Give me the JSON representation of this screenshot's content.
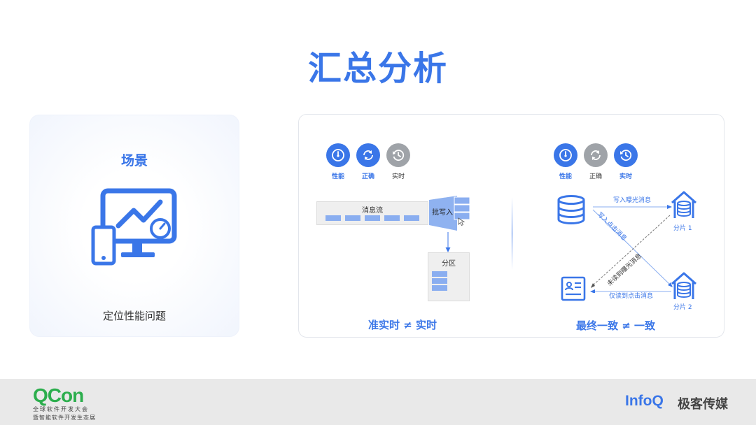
{
  "slide": {
    "title": "汇总分析"
  },
  "scene": {
    "title": "场景",
    "caption": "定位性能问题",
    "illustration_icon": "monitor-phone-chart-icon"
  },
  "left_diagram": {
    "badges": [
      {
        "label": "性能",
        "state": "active",
        "icon": "speedometer-icon"
      },
      {
        "label": "正确",
        "state": "active",
        "icon": "refresh-icon"
      },
      {
        "label": "实时",
        "state": "inactive",
        "icon": "history-clock-icon"
      }
    ],
    "stream_label": "消息流",
    "batch_label": "批写入",
    "partition_label": "分区",
    "caption": "准实时 ≠ 实时"
  },
  "right_diagram": {
    "badges": [
      {
        "label": "性能",
        "state": "active",
        "icon": "speedometer-icon"
      },
      {
        "label": "正确",
        "state": "inactive",
        "icon": "refresh-icon"
      },
      {
        "label": "实时",
        "state": "active",
        "icon": "history-clock-icon"
      }
    ],
    "edge_write_exposure": "写入曝光消息",
    "edge_write_click": "写入点击消息",
    "edge_unread_exposure": "未读到曝光消息",
    "edge_read_click_only": "仅读到点击消息",
    "shard1": "分片 1",
    "shard2": "分片 2",
    "caption": "最终一致 ≠ 一致"
  },
  "footer": {
    "qcon_logo": "QCon",
    "qcon_line1": "全球软件开发大会",
    "qcon_line2": "暨智能软件开发生态展",
    "infoq_logo": "InfoQ",
    "brand_cn": "极客传媒"
  },
  "colors": {
    "accent": "#3a76e8",
    "inactive": "#9fa3a8",
    "qcon_green": "#2cae4d"
  }
}
